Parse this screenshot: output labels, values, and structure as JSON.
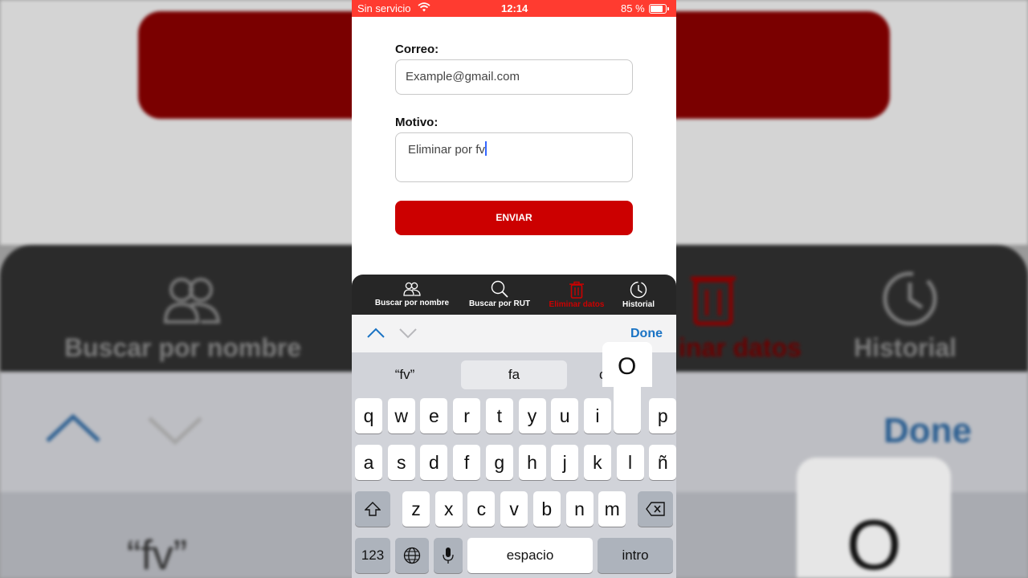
{
  "status_bar": {
    "carrier": "Sin servicio",
    "time": "12:14",
    "battery": "85 %"
  },
  "form": {
    "email_label": "Correo:",
    "email_value": "Example@gmail.com",
    "reason_label": "Motivo:",
    "reason_value": "Eliminar por fv",
    "submit_label": "ENVIAR"
  },
  "tabs": [
    {
      "label": "Buscar por nombre",
      "icon": "people-icon"
    },
    {
      "label": "Buscar por RUT",
      "icon": "search-icon"
    },
    {
      "label": "Eliminar datos",
      "icon": "trash-icon",
      "active": true
    },
    {
      "label": "Historial",
      "icon": "clock-icon"
    }
  ],
  "keyboard_toolbar": {
    "done_label": "Done"
  },
  "keyboard": {
    "suggestions": [
      "“fv”",
      "fa",
      "c"
    ],
    "row1": [
      "q",
      "w",
      "e",
      "r",
      "t",
      "y",
      "u",
      "i",
      "o",
      "p"
    ],
    "row2": [
      "a",
      "s",
      "d",
      "f",
      "g",
      "h",
      "j",
      "k",
      "l",
      "ñ"
    ],
    "row3": [
      "z",
      "x",
      "c",
      "v",
      "b",
      "n",
      "m"
    ],
    "numbers_label": "123",
    "space_label": "espacio",
    "return_label": "intro",
    "popup_key": "O"
  },
  "background": {
    "tab1": "Buscar por nombre",
    "tab3": "inar datos",
    "tab4": "Historial",
    "done": "Done",
    "fv": "“fv”",
    "popup": "O"
  },
  "colors": {
    "status_bar": "#ff3b30",
    "accent_red": "#cc0000",
    "tab_bar": "#262626",
    "link_blue": "#1a73c4"
  }
}
